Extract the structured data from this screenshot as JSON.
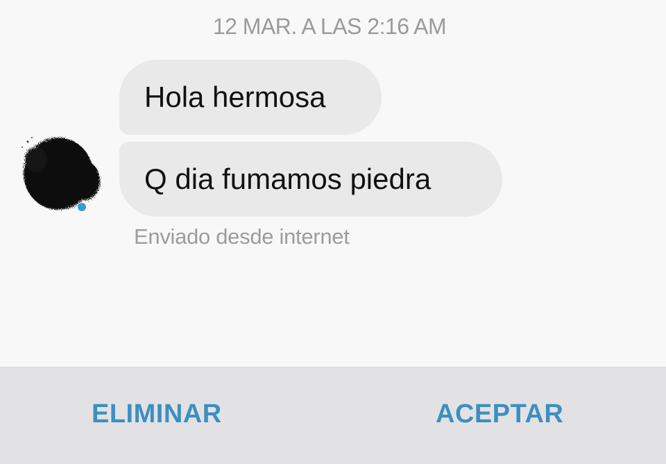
{
  "chat": {
    "timestamp": "12 MAR. A LAS 2:16 AM",
    "messages": [
      {
        "text": "Hola hermosa"
      },
      {
        "text": "Q dia fumamos piedra"
      }
    ],
    "sent_from": "Enviado desde internet"
  },
  "actions": {
    "delete_label": "ELIMINAR",
    "accept_label": "ACEPTAR"
  },
  "colors": {
    "accent": "#3d8fc0",
    "bubble": "#e9e9ea",
    "background": "#f8f8f9",
    "action_bar": "#e2e2e4"
  },
  "icons": {
    "avatar": "blurred-profile-avatar"
  }
}
